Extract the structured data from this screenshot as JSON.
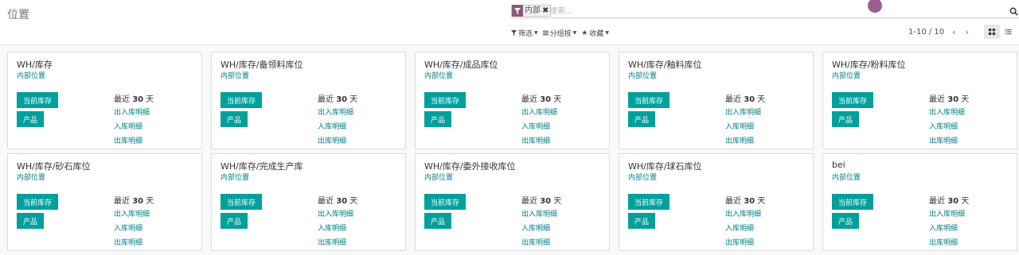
{
  "breadcrumb": "位置",
  "search": {
    "facet_value": "内部",
    "facet_remove": "✖",
    "placeholder": "搜索..."
  },
  "filters": [
    {
      "label": "筛选",
      "icon": "filter-icon"
    },
    {
      "label": "分组按",
      "icon": "list-icon"
    },
    {
      "label": "收藏",
      "icon": "star-icon"
    }
  ],
  "pager": {
    "value": "1-10 / 10",
    "prev": "‹",
    "next": "›"
  },
  "views": [
    "kanban",
    "list"
  ],
  "colors": {
    "accent": "#00a09d",
    "link": "#017e84",
    "facet": "#875a7b",
    "avatar": "#9b5e8f"
  },
  "card_labels": {
    "subtitle": "内部位置",
    "stock_button": "当前库存",
    "product_button": "产品",
    "recent_prefix": "最近",
    "recent_days": "30",
    "recent_suffix": "天",
    "moves": "出入库明细",
    "receipts": "入库明细",
    "deliveries": "出库明细"
  },
  "locations": [
    "WH/库存",
    "WH/库存/备领料库位",
    "WH/库存/成品库位",
    "WH/库存/釉料库位",
    "WH/库存/粉料库位",
    "WH/库存/砂石库位",
    "WH/库存/完成生产库",
    "WH/库存/委外接收库位",
    "WH/库存/球石库位",
    "bei"
  ]
}
